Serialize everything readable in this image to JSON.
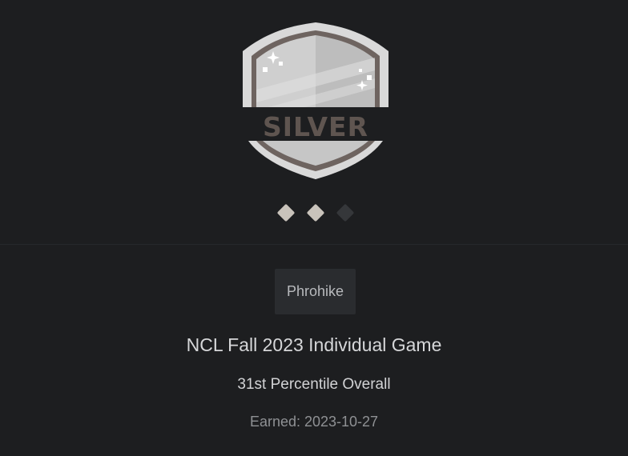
{
  "badge": {
    "tier": "SILVER",
    "rating": {
      "value": 2,
      "max": 3
    },
    "colors": {
      "outer": "#d6d6d6",
      "rim": "#6e6460",
      "body_light": "#d4d4d4",
      "body_dark": "#b9b9b9",
      "banner": "#5f5550",
      "diamond_on": "#c9c3bb",
      "diamond_off": "#35373a"
    }
  },
  "player": {
    "username": "Phrohike"
  },
  "game": {
    "title": "NCL Fall 2023 Individual Game",
    "percentile": "31st Percentile Overall",
    "earned": "Earned: 2023-10-27"
  }
}
